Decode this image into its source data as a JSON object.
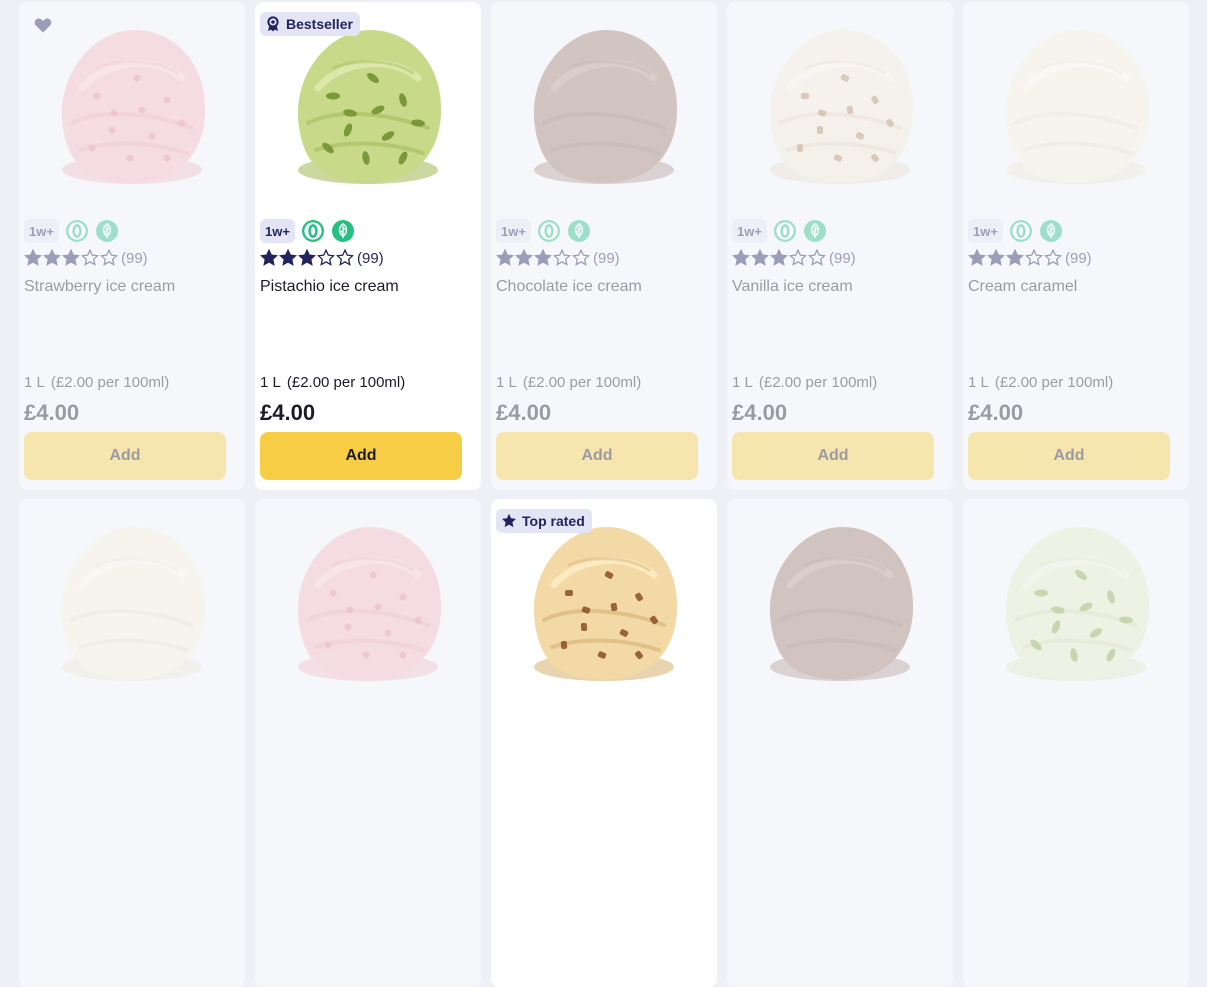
{
  "colors": {
    "accent_button": "#f8cd46",
    "badge_bg": "#e3e5f4",
    "navy": "#23245e",
    "eco_green": "#26c084"
  },
  "products": [
    {
      "name": "Strawberry ice cream",
      "tag": "1w+",
      "rating": 3,
      "review_count": "(99)",
      "size": "1 L",
      "unit_price": "(£2.00 per 100ml)",
      "price": "£4.00",
      "add_label": "Add",
      "flavor": "strawberry",
      "favourite_icon": "heart-icon"
    },
    {
      "name": "Pistachio ice cream",
      "tag": "1w+",
      "rating": 3,
      "review_count": "(99)",
      "size": "1 L",
      "unit_price": "(£2.00 per 100ml)",
      "price": "£4.00",
      "add_label": "Add",
      "flavor": "pistachio",
      "badge": {
        "label": "Bestseller",
        "icon": "award-ribbon-icon"
      }
    },
    {
      "name": "Chocolate ice cream",
      "tag": "1w+",
      "rating": 3,
      "review_count": "(99)",
      "size": "1 L",
      "unit_price": "(£2.00 per 100ml)",
      "price": "£4.00",
      "add_label": "Add",
      "flavor": "chocolate"
    },
    {
      "name": "Vanilla ice cream",
      "tag": "1w+",
      "rating": 3,
      "review_count": "(99)",
      "size": "1 L",
      "unit_price": "(£2.00 per 100ml)",
      "price": "£4.00",
      "add_label": "Add",
      "flavor": "cookies"
    },
    {
      "name": "Cream caramel",
      "tag": "1w+",
      "rating": 3,
      "review_count": "(99)",
      "size": "1 L",
      "unit_price": "(£2.00 per 100ml)",
      "price": "£4.00",
      "add_label": "Add",
      "flavor": "vanilla"
    },
    {
      "flavor": "vanilla"
    },
    {
      "flavor": "strawberry"
    },
    {
      "flavor": "caramel-pecan",
      "badge": {
        "label": "Top rated",
        "icon": "star-icon"
      }
    },
    {
      "flavor": "chocolate"
    },
    {
      "flavor": "pistachio-light"
    }
  ],
  "rating_max": 5,
  "icons": [
    "zero-icon",
    "leaf-icon",
    "heart-icon",
    "award-ribbon-icon",
    "star-icon"
  ]
}
